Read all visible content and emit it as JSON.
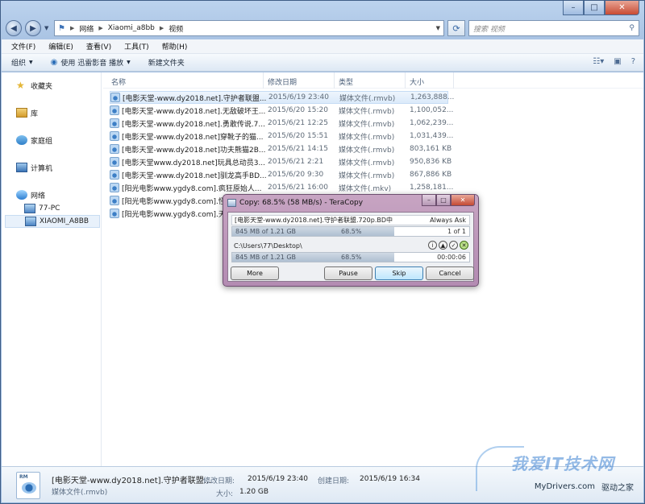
{
  "window": {
    "controls": {
      "min": "–",
      "max": "□",
      "close": "✕"
    }
  },
  "address": {
    "crumbs": [
      "网络",
      "Xiaomi_a8bb",
      "视频"
    ],
    "search_placeholder": "搜索 视频"
  },
  "menu": [
    "文件(F)",
    "编辑(E)",
    "查看(V)",
    "工具(T)",
    "帮助(H)"
  ],
  "commands": {
    "organize": "组织",
    "use_player": "使用 迅雷影音 播放",
    "new_folder": "新建文件夹"
  },
  "nav": {
    "favorites": "收藏夹",
    "library": "库",
    "homegroup": "家庭组",
    "computer": "计算机",
    "network": "网络",
    "pc": "77-PC",
    "xiaomi": "XIAOMI_A8BB"
  },
  "columns": {
    "name": "名称",
    "date": "修改日期",
    "type": "类型",
    "size": "大小"
  },
  "files": [
    {
      "name": "[电影天堂-www.dy2018.net].守护者联盟...",
      "date": "2015/6/19 23:40",
      "type": "媒体文件(.rmvb)",
      "size": "1,263,888..."
    },
    {
      "name": "[电影天堂-www.dy2018.net].无敌破坏王...",
      "date": "2015/6/20 15:20",
      "type": "媒体文件(.rmvb)",
      "size": "1,100,052..."
    },
    {
      "name": "[电影天堂-www.dy2018.net].勇敢传说.7...",
      "date": "2015/6/21 12:25",
      "type": "媒体文件(.rmvb)",
      "size": "1,062,239..."
    },
    {
      "name": "[电影天堂-www.dy2018.net]穿靴子的猫...",
      "date": "2015/6/20 15:51",
      "type": "媒体文件(.rmvb)",
      "size": "1,031,439..."
    },
    {
      "name": "[电影天堂-www.dy2018.net]功夫熊猫2B...",
      "date": "2015/6/21 14:15",
      "type": "媒体文件(.rmvb)",
      "size": "803,161 KB"
    },
    {
      "name": "[电影天堂www.dy2018.net]玩具总动员3...",
      "date": "2015/6/21 2:21",
      "type": "媒体文件(.rmvb)",
      "size": "950,836 KB"
    },
    {
      "name": "[电影天堂-www.dy2018.net]驯龙高手BD...",
      "date": "2015/6/20 9:30",
      "type": "媒体文件(.rmvb)",
      "size": "867,886 KB"
    },
    {
      "name": "[阳光电影www.ygdy8.com].疯狂原始人...",
      "date": "2015/6/21 16:00",
      "type": "媒体文件(.mkv)",
      "size": "1,258,181..."
    },
    {
      "name": "[阳光电影www.ygdy8.com].怪",
      "date": "",
      "type": "",
      "size": ""
    },
    {
      "name": "[阳光电影www.ygdy8.com].天",
      "date": "",
      "type": "",
      "size": ""
    }
  ],
  "details": {
    "file_name": "[电影天堂-www.dy2018.net].守护者联盟...",
    "file_type": "媒体文件(.rmvb)",
    "modified_label": "修改日期:",
    "modified_value": "2015/6/19 23:40",
    "created_label": "创建日期:",
    "created_value": "2015/6/19 16:34",
    "size_label": "大小:",
    "size_value": "1.20 GB",
    "icon_tag": "RM"
  },
  "watermark": {
    "title": "我爱IT技术网",
    "site": "MyDrivers.com",
    "brand": "驱动之家"
  },
  "teracopy": {
    "title": "Copy: 68.5%  (58 MB/s) - TeraCopy",
    "source": "[电影天堂-www.dy2018.net].守护者联盟.720p.BD中",
    "always_ask": "Always Ask",
    "file_progress": {
      "done": "845 MB of 1.21 GB",
      "percent_text": "68.5%",
      "count": "1 of 1",
      "fraction": 0.685
    },
    "target_path": "C:\\Users\\77\\Desktop\\",
    "total_progress": {
      "done": "845 MB of 1.21 GB",
      "percent_text": "68.5%",
      "time": "00:00:06",
      "fraction": 0.685
    },
    "buttons": {
      "more": "More",
      "pause": "Pause",
      "skip": "Skip",
      "cancel": "Cancel"
    }
  }
}
